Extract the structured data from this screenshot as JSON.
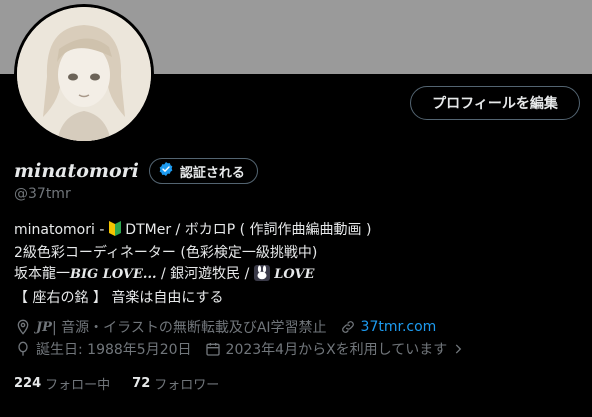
{
  "header": {
    "edit_profile_label": "プロフィールを編集"
  },
  "profile": {
    "display_name": "minatomori",
    "verify_label": "認証される",
    "handle": "@37tmr",
    "bio": {
      "line1_prefix": "minatomori - ",
      "line1_rest": "DTMer / ボカロP ( 作詞作曲編曲動画 )",
      "line2": "2級色彩コーディネーター (色彩検定一級挑戦中)",
      "line3_a": "坂本龍一",
      "line3_b": "BIG LOVE...",
      "line3_c": " / 銀河遊牧民 / ",
      "line3_d": "LOVE",
      "line4": "【 座右の銘 】 音楽は自由にする"
    },
    "location_code": "JP",
    "location_rest": " | 音源・イラストの無断転載及びAI学習禁止",
    "website": "37tmr.com",
    "birthday": "誕生日: 1988年5月20日",
    "joined": "2023年4月からXを利用しています",
    "following_count": "224",
    "following_label": "フォロー中",
    "followers_count": "72",
    "followers_label": "フォロワー"
  },
  "colors": {
    "banner": "#9a9a9a",
    "verified_blue": "#1d9bf0",
    "muted": "#71767b",
    "link": "#1d9bf0"
  }
}
